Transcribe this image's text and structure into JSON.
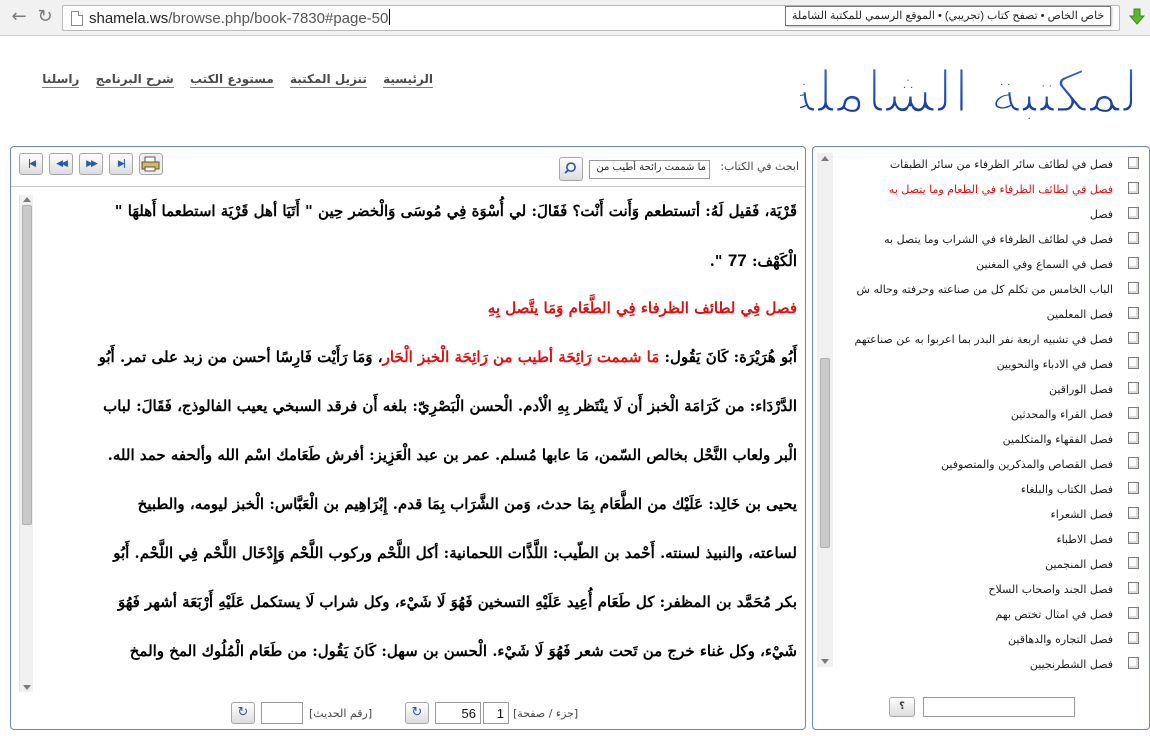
{
  "browser": {
    "url_host": "shamela.ws",
    "url_path": "/browse.php/book-7830#page-50",
    "tooltip": "خاص الخاص • تصفح كتاب (تجريبي) • الموقع الرسمي للمكتبة الشاملة",
    "back_icon": "back-arrow-icon",
    "reload_icon": "reload-icon",
    "download_icon": "download-arrow-icon"
  },
  "header": {
    "logo_text": "المكتبة الشاملة",
    "nav": [
      "الرئيسية",
      "تنزيل المكتبة",
      "مستودع الكتب",
      "شرح البرنامج",
      "راسلنا"
    ]
  },
  "toolbar": {
    "search_label": "ابحث في الكتاب:",
    "search_value": "ما شممت رائحة أطيب من",
    "nav_buttons": [
      "first-page-icon",
      "prev-page-icon",
      "next-page-icon",
      "last-page-icon"
    ]
  },
  "book": {
    "lines": [
      {
        "parts": [
          {
            "t": "قَرْيَة، فَقيل لَهُ: أتستطعم وَأَنت أَنْت؟ فَقَالَ: لي أُسْوَة فِي مُوسَى وَالْخضر حِين \" أَتَيَا أهل قَرْيَة استطعما أَهلهَا \"",
            "red": false
          }
        ]
      },
      {
        "parts": [
          {
            "t": "الْكَهْف: ",
            "red": false
          },
          {
            "t": "77",
            "red": false,
            "num": true
          },
          {
            "t": " \".",
            "red": false
          }
        ]
      },
      {
        "parts": [
          {
            "t": "فصل فِي لطائف الظرفاء فِي الطَّعَام وَمَا يتَّصل بِهِ",
            "red": true
          }
        ]
      },
      {
        "parts": [
          {
            "t": "أَبُو هُرَيْرَة: كَانَ يَقُول: ",
            "red": false
          },
          {
            "t": "مَا شممت رَائِحَة أطيب من رَائِحَة الْخبز الْحَار",
            "red": true
          },
          {
            "t": "، وَمَا رَأَيْت فَارِسًا أحسن من زبد على تمر. أَبُو",
            "red": false
          }
        ]
      },
      {
        "parts": [
          {
            "t": "الدَّرْدَاء: من كَرَامَة الْخبز أَن لَا ينْتَظر بِهِ الْأدم. الْحسن الْبَصْرِيّ: بلغه أَن فرقد السبخي يعيب الفالوذج، فَقَالَ: لباب",
            "red": false
          }
        ]
      },
      {
        "parts": [
          {
            "t": "الْبر ولعاب النَّحْل بخالص السّمن، مَا عابها مُسلم. عمر بن عبد الْعَزِيز: أفرش طَعَامك اسْم الله وألحفه حمد الله.",
            "red": false
          }
        ]
      },
      {
        "parts": [
          {
            "t": "يحيى بن خَالِد: عَلَيْك من الطَّعَام بِمَا حدث، وَمن الشَّرَاب بِمَا قدم. إِبْرَاهِيم بن الْعَبَّاس: الْخبز ليومه، والطبيخ",
            "red": false
          }
        ]
      },
      {
        "parts": [
          {
            "t": "لساعته، والنبيذ لسنته. أَحْمد بن الطّيب: اللَّذَّات اللحمانية: أكل اللَّحْم وركوب اللَّحْم وَإِدْخَال اللَّحْم فِي اللَّحْم. أَبُو",
            "red": false
          }
        ]
      },
      {
        "parts": [
          {
            "t": "بكر مُحَمَّد بن المظفر: كل طَعَام أُعِيد عَلَيْهِ التسخين فَهُوَ لَا شَيْء، وكل شراب لَا يستكمل عَلَيْهِ أَرْبَعَة أشهر فَهُوَ",
            "red": false
          }
        ]
      },
      {
        "parts": [
          {
            "t": "شَيْء، وكل غناء خرج من تَحت شعر فَهُوَ لَا شَيْء. الْحسن بن سهل: كَانَ يَقُول: من طَعَام الْمُلُوك المخ والمخ",
            "red": false
          }
        ]
      }
    ]
  },
  "footer": {
    "part_page_label": "[جزء / صفحة]",
    "part_value": "1",
    "page_value": "56",
    "hadith_label": "[رقم الحديث]",
    "hadith_value": ""
  },
  "sidebar": {
    "items": [
      {
        "label": "فصل في لطائف سائر الظرفاء من سائر الطبقات",
        "active": false
      },
      {
        "label": "فصل في لطائف الظرفاء في الطعام وما يتصل به",
        "active": true
      },
      {
        "label": "فصل",
        "active": false
      },
      {
        "label": "فصل في لطائف الظرفاء في الشراب وما يتصل به",
        "active": false
      },
      {
        "label": "فصل في السماع وفي المغنين",
        "active": false
      },
      {
        "label": "الباب الخامس من تكلم كل من صناعته وحرفته وحاله ش",
        "active": false
      },
      {
        "label": "فصل المعلمين",
        "active": false
      },
      {
        "label": "فصل في تشبيه اربعة نفر البدر بما اعربوا به عن صناعتهم",
        "active": false
      },
      {
        "label": "فصل في الادباء والنحويين",
        "active": false
      },
      {
        "label": "فصل الوراقين",
        "active": false
      },
      {
        "label": "فصل القراء والمحدثين",
        "active": false
      },
      {
        "label": "فصل الفقهاء والمتكلمين",
        "active": false
      },
      {
        "label": "فصل القصاص والمذكرين والمتصوفين",
        "active": false
      },
      {
        "label": "فصل الكتاب والبلغاء",
        "active": false
      },
      {
        "label": "فصل الشعراء",
        "active": false
      },
      {
        "label": "فصل الاطباء",
        "active": false
      },
      {
        "label": "فصل المنجمين",
        "active": false
      },
      {
        "label": "فصل الجند واصحاب السلاح",
        "active": false
      },
      {
        "label": "فصل في امثال تختص بهم",
        "active": false
      },
      {
        "label": "فصل التجاره والدهاقين",
        "active": false
      },
      {
        "label": "فصل الشطرنجيين",
        "active": false
      }
    ],
    "help_button": "؟"
  }
}
